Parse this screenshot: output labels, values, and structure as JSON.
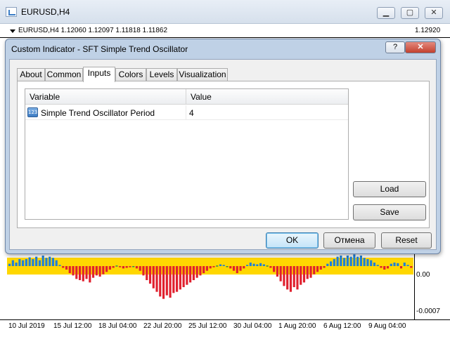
{
  "chart_window": {
    "title": "EURUSD,H4",
    "controls": {
      "minimize": "▁",
      "maximize": "▢",
      "close": "✕"
    },
    "info_line": "EURUSD,H4  1.12060 1.12097 1.11818 1.11862",
    "price_label": "1.12920"
  },
  "oscillator": {
    "scale_labels": [
      "0.00",
      "-0.0007"
    ],
    "time_labels": [
      "10 Jul 2019",
      "15 Jul 12:00",
      "18 Jul 04:00",
      "22 Jul 20:00",
      "25 Jul 12:00",
      "30 Jul 04:00",
      "1 Aug 20:00",
      "6 Aug 12:00",
      "9 Aug 04:00"
    ],
    "colors": {
      "band": "#ffd700",
      "positive": "#1e7fd8",
      "negative": "#e0202e",
      "neutral": "#2e8b57"
    }
  },
  "chart_data": {
    "type": "bar",
    "y_range": [
      -0.0009,
      0.0003
    ],
    "values": [
      4e-05,
      0.0001,
      6e-05,
      0.00012,
      0.0001,
      0.00012,
      0.00015,
      0.00012,
      0.00016,
      0.0001,
      0.00018,
      0.00014,
      0.00016,
      0.00014,
      0.0001,
      2e-05,
      -3e-05,
      -6e-05,
      -0.00012,
      -0.00016,
      -0.00022,
      -0.00024,
      -0.00026,
      -0.00022,
      -0.00028,
      -0.0002,
      -0.00016,
      -0.00018,
      -0.00014,
      -0.0001,
      -6e-05,
      -3e-05,
      1e-05,
      -2e-05,
      -4e-05,
      -3e-05,
      -2e-05,
      -1e-05,
      -4e-05,
      -8e-05,
      -0.00016,
      -0.00024,
      -0.0003,
      -0.00038,
      -0.00044,
      -0.00052,
      -0.00056,
      -0.0005,
      -0.00054,
      -0.00046,
      -0.00044,
      -0.0004,
      -0.00036,
      -0.00032,
      -0.00028,
      -0.00024,
      -0.0002,
      -0.00016,
      -0.00012,
      -8e-05,
      -4e-05,
      -2e-05,
      1e-05,
      3e-05,
      2e-05,
      -1e-05,
      -4e-05,
      -8e-05,
      -0.00012,
      -8e-05,
      -4e-05,
      2e-05,
      6e-05,
      4e-05,
      3e-05,
      5e-05,
      3e-05,
      1e-05,
      -3e-05,
      -0.0001,
      -0.00018,
      -0.00026,
      -0.00034,
      -0.0004,
      -0.00044,
      -0.00036,
      -0.0004,
      -0.00032,
      -0.00028,
      -0.00022,
      -0.0002,
      -0.00014,
      -0.0001,
      -6e-05,
      -3e-05,
      4e-05,
      8e-05,
      0.00012,
      0.00016,
      0.00018,
      0.00014,
      0.00018,
      0.00016,
      0.0002,
      0.00016,
      0.00018,
      0.00014,
      0.00012,
      0.0001,
      6e-05,
      2e-05,
      -3e-05,
      -6e-05,
      -4e-05,
      4e-05,
      6e-05,
      5e-05,
      -4e-05,
      6e-05,
      2e-05,
      -3e-05
    ]
  },
  "dialog": {
    "title": "Custom Indicator - SFT Simple Trend Oscillator",
    "help_btn": "?",
    "close_btn": "✕",
    "tabs": [
      "About",
      "Common",
      "Inputs",
      "Colors",
      "Levels",
      "Visualization"
    ],
    "active_tab": "Inputs",
    "grid": {
      "col_variable": "Variable",
      "col_value": "Value",
      "rows": [
        {
          "icon": "123",
          "variable": "Simple Trend Oscillator Period",
          "value": "4"
        }
      ]
    },
    "load_btn": "Load",
    "save_btn": "Save",
    "ok_btn": "OK",
    "cancel_btn": "Отмена",
    "reset_btn": "Reset"
  }
}
